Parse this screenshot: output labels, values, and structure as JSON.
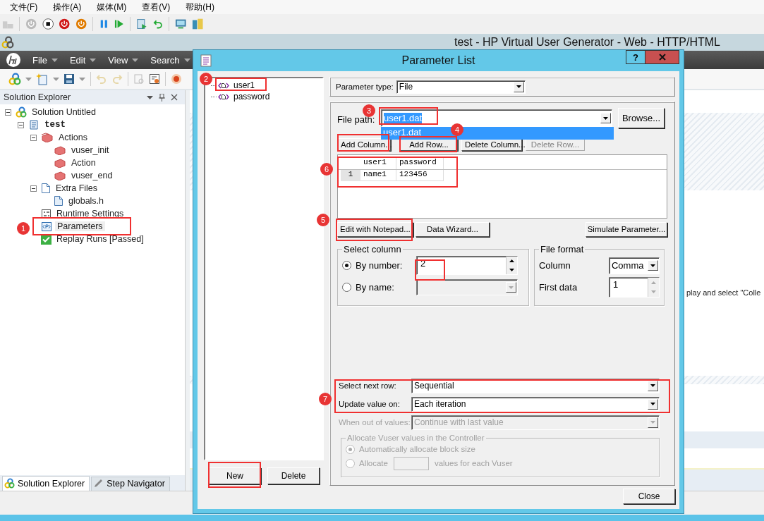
{
  "menu_bar": [
    "文件(F)",
    "操作(A)",
    "媒体(M)",
    "查看(V)",
    "帮助(H)"
  ],
  "app_title": "test - HP Virtual User Generator - Web - HTTP/HTML",
  "main_menu": [
    "File",
    "Edit",
    "View",
    "Search"
  ],
  "solution_explorer": {
    "title": "Solution Explorer",
    "tree": [
      {
        "label": "Solution Untitled",
        "kind": "solution",
        "selected": false,
        "expanded": true,
        "children": [
          {
            "label": "test",
            "kind": "script",
            "selected": false,
            "expanded": true,
            "children": [
              {
                "label": "Actions",
                "kind": "actions",
                "selected": false,
                "expanded": true,
                "children": [
                  {
                    "label": "vuser_init",
                    "kind": "action",
                    "selected": false
                  },
                  {
                    "label": "Action",
                    "kind": "action",
                    "selected": false
                  },
                  {
                    "label": "vuser_end",
                    "kind": "action",
                    "selected": false
                  }
                ]
              },
              {
                "label": "Extra Files",
                "kind": "folder",
                "selected": false,
                "expanded": true,
                "children": [
                  {
                    "label": "globals.h",
                    "kind": "file",
                    "selected": false
                  }
                ]
              },
              {
                "label": "Runtime Settings",
                "kind": "settings",
                "selected": false
              },
              {
                "label": "Parameters",
                "kind": "parameters",
                "selected": true
              },
              {
                "label": "Replay Runs [Passed]",
                "kind": "check",
                "selected": false
              }
            ]
          }
        ]
      }
    ]
  },
  "bottom_tabs": [
    {
      "label": "Solution Explorer",
      "selected": true
    },
    {
      "label": "Step Navigator",
      "selected": false
    }
  ],
  "content_snippet": "play and select \"Colle",
  "dialog": {
    "title": "Parameter List",
    "help": "?",
    "parameters": [
      "user1",
      "password"
    ],
    "new_button": "New",
    "delete_button": "Delete",
    "parameter_type": {
      "label": "Parameter type:",
      "value": "File"
    },
    "file_path": {
      "label": "File path:",
      "value": "user1.dat",
      "option": "user1.dat"
    },
    "browse_button": "Browse...",
    "column_buttons": [
      {
        "label": "Add Column...",
        "disabled": false
      },
      {
        "label": "Add Row...",
        "disabled": false
      },
      {
        "label": "Delete Column...",
        "disabled": false
      },
      {
        "label": "Delete Row...",
        "disabled": true
      }
    ],
    "table": {
      "columns": [
        "user1",
        "password"
      ],
      "rows": [
        {
          "number": "1",
          "cells": [
            "name1",
            "123456"
          ]
        }
      ]
    },
    "edit_buttons": [
      "Edit with Notepad...",
      "Data Wizard..."
    ],
    "simulate_button": "Simulate Parameter...",
    "select_column": {
      "title": "Select column",
      "options": [
        {
          "label": "By number:",
          "selected": true,
          "value": "2"
        },
        {
          "label": "By name:",
          "selected": false
        }
      ]
    },
    "file_format": {
      "title": "File format",
      "column_label": "Column",
      "column_value": "Comma",
      "first_data_label": "First data",
      "first_data_value": "1"
    },
    "settings": [
      {
        "label": "Select next row:",
        "value": "Sequential",
        "disabled": false
      },
      {
        "label": "Update value on:",
        "value": "Each iteration",
        "disabled": false
      },
      {
        "label": "When out of values:",
        "value": "Continue with last value",
        "disabled": true
      }
    ],
    "allocate": {
      "title": "Allocate Vuser values in the Controller",
      "options": [
        {
          "label": "Automatically allocate block size",
          "selected": true
        },
        {
          "label": "Allocate",
          "selected": false,
          "suffix": "values for each Vuser"
        }
      ]
    },
    "close_button": "Close"
  },
  "annotations": [
    "1",
    "2",
    "3",
    "4",
    "5",
    "6",
    "7"
  ]
}
